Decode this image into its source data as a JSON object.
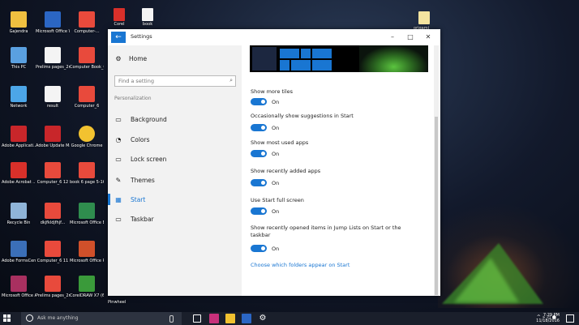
{
  "desktop": {
    "icons": [
      {
        "label": "Gajendra",
        "color": "#f0c040"
      },
      {
        "label": "Microsoft Office Wo...",
        "color": "#2b66c4"
      },
      {
        "label": "Computer-...",
        "color": "#e84a3c"
      },
      {
        "label": "This PC",
        "color": "#5aa0e0"
      },
      {
        "label": "Prelims pages_2n_v...",
        "color": "#f4f4f4"
      },
      {
        "label": "Computer Book_01_...",
        "color": "#e84a3c"
      },
      {
        "label": "Network",
        "color": "#4ca6e8"
      },
      {
        "label": "result",
        "color": "#f4f4f4"
      },
      {
        "label": "Computer_6",
        "color": "#e84a3c"
      },
      {
        "label": "Adobe Applicati...",
        "color": "#c8262a"
      },
      {
        "label": "Adobe Update Ma...",
        "color": "#c8262a"
      },
      {
        "label": "Google Chrome",
        "color": "#f2c230"
      },
      {
        "label": "Adobe Acrobat ...",
        "color": "#d8302a"
      },
      {
        "label": "Computer_6 12",
        "color": "#e84a3c"
      },
      {
        "label": "book 6 page 5-16",
        "color": "#e84a3c"
      },
      {
        "label": "Recycle Bin",
        "color": "#8fb4d8"
      },
      {
        "label": "dkjfkldjfhjf...",
        "color": "#e84a3c"
      },
      {
        "label": "Microsoft Office Exc...",
        "color": "#2f8d4e"
      },
      {
        "label": "Adobe FormsCentral",
        "color": "#3b6fb8"
      },
      {
        "label": "Computer_6 11",
        "color": "#e84a3c"
      },
      {
        "label": "Microsoft Office Po...",
        "color": "#d0502a"
      },
      {
        "label": "Microsoft Office Acce...",
        "color": "#a83060"
      },
      {
        "label": "Prelims pages_2n_v...",
        "color": "#e84a3c"
      },
      {
        "label": "CorelDRAW X7 (64-Bit)",
        "color": "#3a9a3a"
      }
    ],
    "top_icons": [
      {
        "label": "Corel",
        "color": "#d8302a"
      },
      {
        "label": "book",
        "color": "#f4f4f4"
      }
    ],
    "extra_labels": {
      "pinwheel": "Pinwheel",
      "origami": "origami"
    }
  },
  "window": {
    "title": "Settings",
    "back_glyph": "←",
    "minimize_glyph": "–",
    "maximize_glyph": "□",
    "close_glyph": "✕"
  },
  "nav": {
    "home": "Home",
    "search_placeholder": "Find a setting",
    "section": "Personalization",
    "items": [
      {
        "label": "Background",
        "icon": "image-icon",
        "glyph": "▭"
      },
      {
        "label": "Colors",
        "icon": "palette-icon",
        "glyph": "◔"
      },
      {
        "label": "Lock screen",
        "icon": "lock-screen-icon",
        "glyph": "▭"
      },
      {
        "label": "Themes",
        "icon": "brush-icon",
        "glyph": "✎"
      },
      {
        "label": "Start",
        "icon": "start-icon",
        "glyph": "▦",
        "active": true
      },
      {
        "label": "Taskbar",
        "icon": "taskbar-icon",
        "glyph": "▭"
      }
    ]
  },
  "settings": [
    {
      "label": "Show more tiles",
      "state": "On"
    },
    {
      "label": "Occasionally show suggestions in Start",
      "state": "On"
    },
    {
      "label": "Show most used apps",
      "state": "On"
    },
    {
      "label": "Show recently added apps",
      "state": "On"
    },
    {
      "label": "Use Start full screen",
      "state": "On"
    },
    {
      "label": "Show recently opened items in Jump Lists on Start or the taskbar",
      "state": "On"
    }
  ],
  "link": "Choose which folders appear on Start",
  "taskbar": {
    "search_text": "Ask me anything",
    "time": "7:29 PM",
    "date": "11/18/2016",
    "tray_glyphs": "^ ⌁ ◁ ●"
  },
  "colors": {
    "accent": "#1976d2"
  }
}
